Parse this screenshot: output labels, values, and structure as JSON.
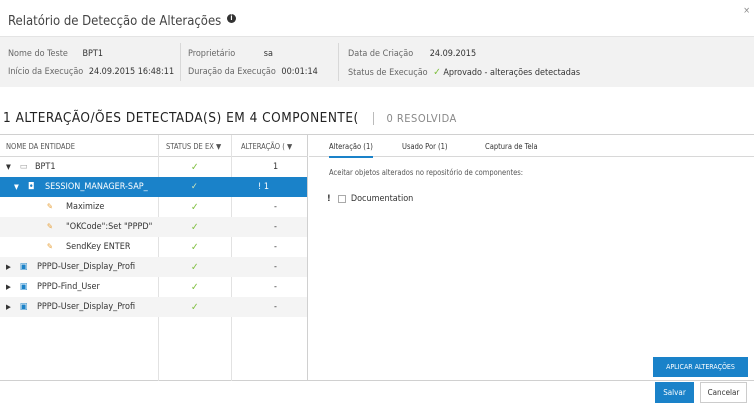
{
  "dialog": {
    "title": "Relatório de Detecção de Alterações",
    "info_glyph": "i",
    "close_glyph": "×"
  },
  "summary": {
    "test_name_label": "Nome do Teste",
    "test_name_value": "BPT1",
    "run_start_label": "Início da Execução",
    "run_start_value": "24.09.2015 16:48:11",
    "owner_label": "Proprietário",
    "owner_value": "sa",
    "run_duration_label": "Duração da Execução",
    "run_duration_value": "00:01:14",
    "created_label": "Data de Criação",
    "created_value": "24.09.2015",
    "run_status_label": "Status de Execução",
    "run_status_value": "Aprovado - alterações detectadas",
    "status_color": "#7fbf3f"
  },
  "heading": {
    "detected": "1 ALTERAÇÃO/ÕES DETECTADA(S) EM 4 COMPONENTE(",
    "resolved": "0 RESOLVIDA"
  },
  "table": {
    "col_entity": "NOME DA ENTIDADE",
    "col_status": "STATUS DE EX",
    "col_changes": "ALTERAÇÃO (",
    "sort_glyph": "▼",
    "check_glyph": "✓",
    "rows": [
      {
        "caret": "▼",
        "icon": "▭",
        "name": "BPT1",
        "status": "✓",
        "changes": "1"
      },
      {
        "caret": "▼",
        "icon": "◘",
        "name": "SESSION_MANAGER-SAP_",
        "status": "✓",
        "changes": "! 1"
      },
      {
        "caret": "",
        "icon": "✎",
        "name": "Maximize",
        "status": "✓",
        "changes": "-"
      },
      {
        "caret": "",
        "icon": "✎",
        "name": "\"OKCode\":Set \"PPPD\"",
        "status": "✓",
        "changes": "-"
      },
      {
        "caret": "",
        "icon": "✎",
        "name": "SendKey ENTER",
        "status": "✓",
        "changes": "-"
      },
      {
        "caret": "▶",
        "icon": "▣",
        "name": "PPPD-User_Display_Profi",
        "status": "✓",
        "changes": "-"
      },
      {
        "caret": "▶",
        "icon": "▣",
        "name": "PPPD-Find_User",
        "status": "✓",
        "changes": "-"
      },
      {
        "caret": "▶",
        "icon": "▣",
        "name": "PPPD-User_Display_Profi",
        "status": "✓",
        "changes": "-"
      }
    ]
  },
  "tabs": {
    "change": "Alteração (1)",
    "used_by": "Usado Por (1)",
    "screenshot": "Captura de Tela"
  },
  "details": {
    "description": "Aceitar objetos alterados no repositório de componentes:",
    "marker": "!",
    "item": "Documentation",
    "apply_button": "APLICAR ALTERAÇÕES"
  },
  "footer": {
    "save": "Salvar",
    "cancel": "Cancelar"
  },
  "colors": {
    "accent": "#1a82c9",
    "selected_row": "#1a82c9",
    "summary_bg": "#f2f2f2"
  }
}
